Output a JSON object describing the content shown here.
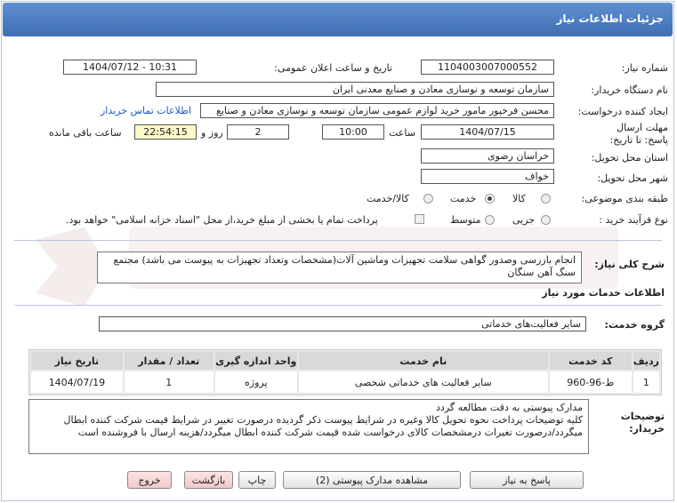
{
  "header": {
    "title": "جزئیات اطلاعات نیاز"
  },
  "need_number": {
    "label": "شماره نیاز:",
    "value": "1104003007000552"
  },
  "announce_datetime": {
    "label": "تاریخ و ساعت اعلان عمومی:",
    "value": "1404/07/12 - 10:31"
  },
  "buyer_org": {
    "label": "نام دستگاه خریدار:",
    "value": "سازمان توسعه و نوسازی معادن و صنایع معدنی ایران"
  },
  "requester": {
    "label": "ایجاد کننده درخواست:",
    "value": "محسن فرخپور مامور خرید لوازم عمومی سازمان توسعه و نوسازی معادن و صنایع",
    "contact_link": "اطلاعات تماس خریدار"
  },
  "deadline": {
    "label": "مهلت ارسال پاسخ: تا تاریخ:",
    "date": "1404/07/15",
    "time_label": "ساعت",
    "time": "10:00",
    "days": "2",
    "days_label": "روز و",
    "remaining": "22:54:15",
    "remaining_label": "ساعت باقی مانده"
  },
  "province": {
    "label": "استان محل تحویل:",
    "value": "خراسان رضوی"
  },
  "city": {
    "label": "شهر محل تحویل:",
    "value": "خواف"
  },
  "category": {
    "label": "طبقه بندی موضوعی:",
    "options": [
      "کالا",
      "خدمت",
      "کالا/خدمت"
    ],
    "selected": "خدمت"
  },
  "purchase_process": {
    "label": "نوع فرآیند خرید :",
    "options": [
      "جزیی",
      "متوسط"
    ],
    "selected": "",
    "payment_note": "پرداخت تمام یا بخشی از مبلغ خرید،از محل \"اسناد خزانه اسلامی\" خواهد بود."
  },
  "need_description": {
    "label": "شرح کلی نیاز:",
    "value": "انجام بازرسی وصدور گواهی سلامت تجهیزات وماشین آلات(مشخصات وتعداد تجهیزات به پیوست می باشد) مجتمع سنگ آهن سنگان"
  },
  "services_info": {
    "title": "اطلاعات خدمات مورد نیاز"
  },
  "service_group": {
    "label": "گروه خدمت:",
    "value": "سایر فعالیت‌های خدماتی"
  },
  "table": {
    "headers": [
      "ردیف",
      "کد خدمت",
      "نام خدمت",
      "واحد اندازه گیری",
      "تعداد / مقدار",
      "تاریخ نیاز"
    ],
    "rows": [
      [
        "1",
        "ط-96-960",
        "سایر فعالیت های خدماتی شخصی",
        "پروژه",
        "1",
        "1404/07/19"
      ]
    ]
  },
  "buyer_notes": {
    "label": "توضیحات خریدار:",
    "lines": [
      "مدارک پیوستی به دقت مطالعه گردد",
      "کلیه توضیحات پرداخت نحوه تحویل کالا وغیره در شرایط پیوست ذکر گردیده درصورت تغییر در شرایط  قیمت شرکت کننده ابطال",
      "میگردد/درصورت تغیرات درمشخصات کالای درخواست شده قیمت شرکت کننده ابطال میگردد/هزینه ارسال با فروشنده است"
    ]
  },
  "buttons": {
    "reply": "پاسخ به نیاز",
    "attachments": "مشاهده مدارک پیوستی (2)",
    "print": "چاپ",
    "back": "بازگشت",
    "exit": "خروج"
  },
  "colors": {
    "header_bg": "#3f6fb3",
    "link": "#1a58c8",
    "remaining_bg": "#fff8c8",
    "watermark": "#e9d9d9"
  }
}
